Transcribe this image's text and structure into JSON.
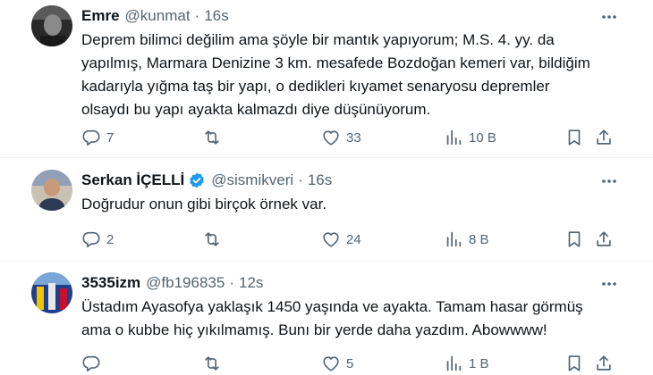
{
  "tweets": [
    {
      "name": "Emre",
      "handle": "@kunmat",
      "sep": "·",
      "time": "16s",
      "verified": false,
      "lines": [
        "Deprem bilimci değilim ama şöyle bir mantık yapıyorum; M.S. 4. yy. da",
        "yapılmış, Marmara Denizine 3 km. mesafede Bozdoğan kemeri var, bildiğim",
        "kadarıyla yığma taş bir yapı, o dedikleri kıyamet senaryosu depremler",
        "olsaydı bu yapı ayakta kalmazdı diye düşünüyorum."
      ],
      "replies": "7",
      "retweets": "",
      "likes": "33",
      "views": "10 B"
    },
    {
      "name": "Serkan İÇELLİ",
      "handle": "@sismikveri",
      "sep": "·",
      "time": "16s",
      "verified": true,
      "lines": [
        "Doğrudur onun gibi birçok örnek var."
      ],
      "replies": "2",
      "retweets": "",
      "likes": "24",
      "views": "8 B"
    },
    {
      "name": "3535izm",
      "handle": "@fb196835",
      "sep": "·",
      "time": "12s",
      "verified": false,
      "lines": [
        "Üstadım Ayasofya yaklaşık 1450 yaşında ve ayakta. Tamam hasar görmüş",
        "ama o kubbe hiç yıkılmamış. Bunı bir yerde daha yazdım. Abowwww!"
      ],
      "replies": "",
      "retweets": "",
      "likes": "5",
      "views": "1 B"
    }
  ],
  "icons": {
    "reply": "reply-icon",
    "retweet": "retweet-icon",
    "like": "heart-icon",
    "views": "views-icon",
    "bookmark": "bookmark-icon",
    "share": "share-icon",
    "more": "more-icon",
    "verified": "verified-badge-icon"
  },
  "colors": {
    "text": "#0f1419",
    "secondary": "#536471",
    "verified": "#1d9bf0",
    "divider": "#eff3f4"
  }
}
